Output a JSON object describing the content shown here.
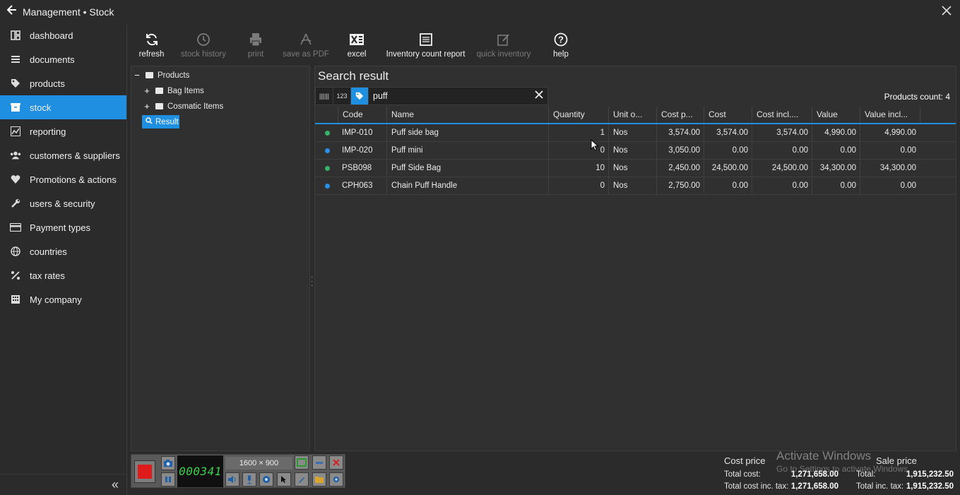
{
  "titlebar": {
    "title": "Management • Stock",
    "back_icon": "arrow-left-icon",
    "close_icon": "close-icon"
  },
  "sidebar": {
    "items": [
      {
        "label": "dashboard",
        "icon": "dashboard-icon",
        "active": false
      },
      {
        "label": "documents",
        "icon": "documents-icon",
        "active": false
      },
      {
        "label": "products",
        "icon": "tag-icon",
        "active": false
      },
      {
        "label": "stock",
        "icon": "box-icon",
        "active": true
      },
      {
        "label": "reporting",
        "icon": "chart-icon",
        "active": false
      },
      {
        "label": "customers & suppliers",
        "icon": "users-icon",
        "active": false
      },
      {
        "label": "Promotions & actions",
        "icon": "heart-icon",
        "active": false
      },
      {
        "label": "users & security",
        "icon": "wrench-icon",
        "active": false
      },
      {
        "label": "Payment types",
        "icon": "card-icon",
        "active": false
      },
      {
        "label": "countries",
        "icon": "globe-icon",
        "active": false
      },
      {
        "label": "tax rates",
        "icon": "percent-icon",
        "active": false
      },
      {
        "label": "My company",
        "icon": "building-icon",
        "active": false
      }
    ],
    "collapse_icon": "double-chevron-left-icon"
  },
  "toolbar": {
    "buttons": [
      {
        "label": "refresh",
        "icon": "refresh-icon",
        "enabled": true
      },
      {
        "label": "stock history",
        "icon": "history-icon",
        "enabled": false
      },
      {
        "label": "print",
        "icon": "print-icon",
        "enabled": false
      },
      {
        "label": "save as PDF",
        "icon": "pdf-icon",
        "enabled": false
      },
      {
        "label": "excel",
        "icon": "excel-icon",
        "enabled": true
      },
      {
        "label": "Inventory count report",
        "icon": "report-icon",
        "enabled": true
      },
      {
        "label": "quick inventory",
        "icon": "edit-icon",
        "enabled": false
      },
      {
        "label": "help",
        "icon": "help-icon",
        "enabled": true
      }
    ]
  },
  "tree": {
    "root": {
      "label": "Products",
      "toggle": "−"
    },
    "children": [
      {
        "label": "Bag Items",
        "toggle": "+"
      },
      {
        "label": "Cosmatic Items",
        "toggle": "+"
      }
    ],
    "result": {
      "label": "Result",
      "icon": "search-icon"
    }
  },
  "results": {
    "heading": "Search result",
    "search": {
      "value": "puff",
      "barcode_label": "||||||",
      "numeric_label": "123"
    },
    "products_count": "Products count: 4",
    "columns": [
      "Code",
      "Name",
      "Quantity",
      "Unit o...",
      "Cost p...",
      "Cost",
      "Cost incl....",
      "Value",
      "Value incl..."
    ],
    "rows": [
      {
        "status": "#35b36a",
        "code": "IMP-010",
        "name": "Puff side bag",
        "quantity": "1",
        "unit": "Nos",
        "cost_price": "3,574.00",
        "cost": "3,574.00",
        "cost_incl": "3,574.00",
        "value": "4,990.00",
        "value_incl": "4,990.00"
      },
      {
        "status": "#2a8fe6",
        "code": "IMP-020",
        "name": "Puff mini",
        "quantity": "0",
        "unit": "Nos",
        "cost_price": "3,050.00",
        "cost": "0.00",
        "cost_incl": "0.00",
        "value": "0.00",
        "value_incl": "0.00"
      },
      {
        "status": "#35b36a",
        "code": "PSB098",
        "name": "Puff Side Bag",
        "quantity": "10",
        "unit": "Nos",
        "cost_price": "2,450.00",
        "cost": "24,500.00",
        "cost_incl": "24,500.00",
        "value": "34,300.00",
        "value_incl": "34,300.00"
      },
      {
        "status": "#2a8fe6",
        "code": "CPH063",
        "name": "Chain Puff Handle",
        "quantity": "0",
        "unit": "Nos",
        "cost_price": "2,750.00",
        "cost": "0.00",
        "cost_incl": "0.00",
        "value": "0.00",
        "value_incl": "0.00"
      }
    ]
  },
  "summary": {
    "cost_title": "Cost price",
    "total_cost_label": "Total cost:",
    "total_cost": "1,271,658.00",
    "total_cost_tax_label": "Total cost inc. tax:",
    "total_cost_tax": "1,271,658.00",
    "sale_title": "Sale price",
    "total_label": "Total:",
    "total": "1,915,232.50",
    "total_tax_label": "Total inc. tax:",
    "total_tax": "1,915,232.50"
  },
  "watermark": {
    "line1": "Activate Windows",
    "line2": "Go to Settings to activate Windows."
  },
  "recorder": {
    "timer": "000341",
    "resolution": "1600 × 900"
  },
  "colors": {
    "accent": "#1e8fe1",
    "background": "#2b2b2b",
    "record": "#e01b1b",
    "timer_text": "#3ad04a"
  }
}
